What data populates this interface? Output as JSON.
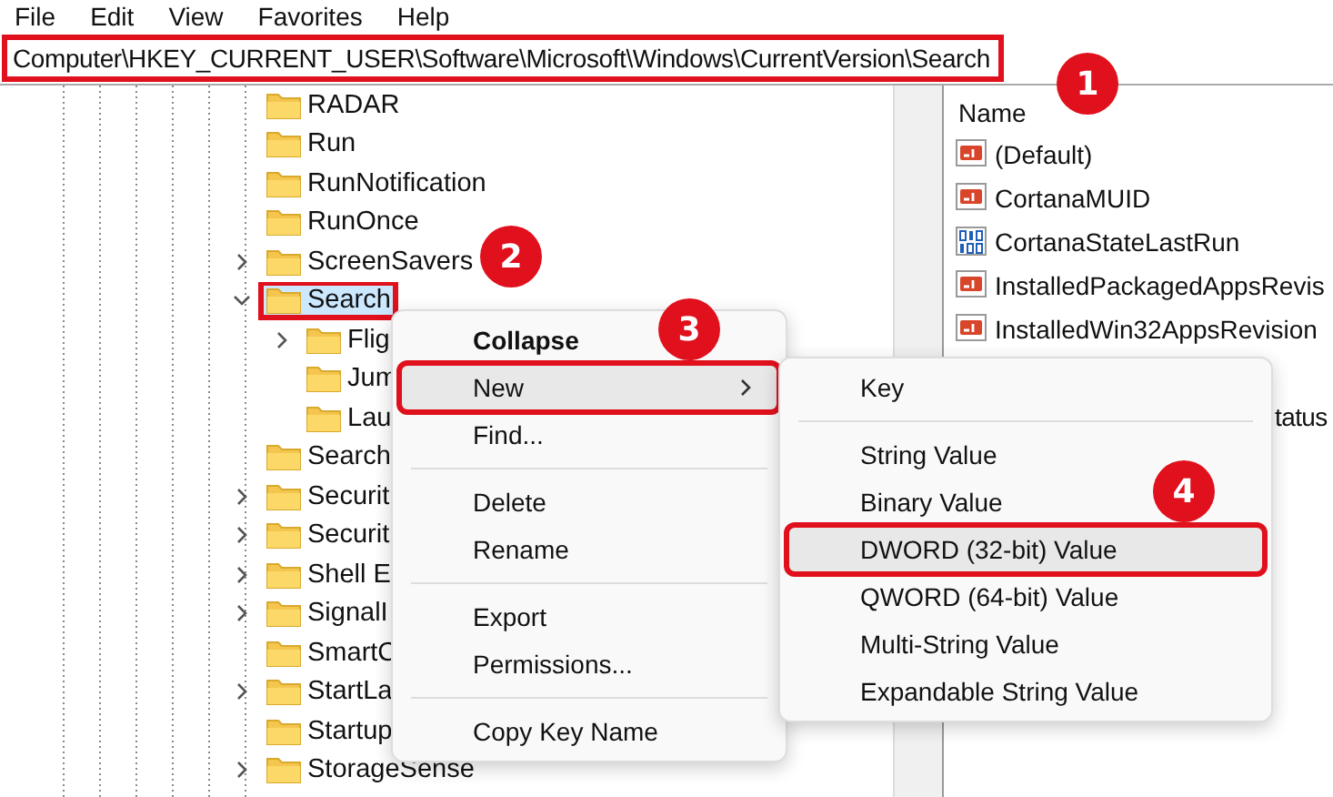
{
  "menubar": [
    "File",
    "Edit",
    "View",
    "Favorites",
    "Help"
  ],
  "address": {
    "value": "Computer\\HKEY_CURRENT_USER\\Software\\Microsoft\\Windows\\CurrentVersion\\Search",
    "annotated": true
  },
  "tree": [
    {
      "label": "RADAR",
      "expandable": false,
      "expanded": false,
      "selected": false,
      "annotated": false
    },
    {
      "label": "Run",
      "expandable": false,
      "expanded": false,
      "selected": false,
      "annotated": false
    },
    {
      "label": "RunNotification",
      "expandable": false,
      "expanded": false,
      "selected": false,
      "annotated": false
    },
    {
      "label": "RunOnce",
      "expandable": false,
      "expanded": false,
      "selected": false,
      "annotated": false
    },
    {
      "label": "ScreenSavers",
      "expandable": true,
      "expanded": false,
      "selected": false,
      "annotated": false
    },
    {
      "label": "Search",
      "expandable": true,
      "expanded": true,
      "selected": true,
      "annotated": true,
      "children": [
        {
          "label": "Flig",
          "expandable": true,
          "expanded": false,
          "selected": false,
          "annotated": false
        },
        {
          "label": "Jum",
          "expandable": false,
          "expanded": false,
          "selected": false,
          "annotated": false
        },
        {
          "label": "Lau",
          "expandable": false,
          "expanded": false,
          "selected": false,
          "annotated": false
        }
      ]
    },
    {
      "label": "Search",
      "expandable": false,
      "expanded": false,
      "selected": false,
      "annotated": false
    },
    {
      "label": "Securit",
      "expandable": true,
      "expanded": false,
      "selected": false,
      "annotated": false
    },
    {
      "label": "Securit",
      "expandable": true,
      "expanded": false,
      "selected": false,
      "annotated": false
    },
    {
      "label": "Shell E",
      "expandable": true,
      "expanded": false,
      "selected": false,
      "annotated": false
    },
    {
      "label": "SignalI",
      "expandable": true,
      "expanded": false,
      "selected": false,
      "annotated": false
    },
    {
      "label": "SmartC",
      "expandable": false,
      "expanded": false,
      "selected": false,
      "annotated": false
    },
    {
      "label": "StartLa",
      "expandable": true,
      "expanded": false,
      "selected": false,
      "annotated": false
    },
    {
      "label": "Startup",
      "expandable": false,
      "expanded": false,
      "selected": false,
      "annotated": false
    },
    {
      "label": "StorageSense",
      "expandable": true,
      "expanded": false,
      "selected": false,
      "annotated": false
    }
  ],
  "values": {
    "column": "Name",
    "rows": [
      {
        "kind": "string",
        "name": "(Default)"
      },
      {
        "kind": "string",
        "name": "CortanaMUID"
      },
      {
        "kind": "binary",
        "name": "CortanaStateLastRun"
      },
      {
        "kind": "string",
        "name": "InstalledPackagedAppsRevis"
      },
      {
        "kind": "string",
        "name": "InstalledWin32AppsRevision"
      },
      {
        "kind": "partial",
        "name": "tatus"
      }
    ]
  },
  "context_menu": [
    {
      "kind": "item",
      "label": "Collapse",
      "default": true,
      "submenu": false,
      "highlighted": false,
      "annotated": false
    },
    {
      "kind": "item",
      "label": "New",
      "default": false,
      "submenu": true,
      "highlighted": true,
      "annotated": true
    },
    {
      "kind": "item",
      "label": "Find...",
      "default": false,
      "submenu": false,
      "highlighted": false,
      "annotated": false
    },
    {
      "kind": "separator"
    },
    {
      "kind": "item",
      "label": "Delete",
      "default": false,
      "submenu": false,
      "highlighted": false,
      "annotated": false
    },
    {
      "kind": "item",
      "label": "Rename",
      "default": false,
      "submenu": false,
      "highlighted": false,
      "annotated": false
    },
    {
      "kind": "separator"
    },
    {
      "kind": "item",
      "label": "Export",
      "default": false,
      "submenu": false,
      "highlighted": false,
      "annotated": false
    },
    {
      "kind": "item",
      "label": "Permissions...",
      "default": false,
      "submenu": false,
      "highlighted": false,
      "annotated": false
    },
    {
      "kind": "separator"
    },
    {
      "kind": "item",
      "label": "Copy Key Name",
      "default": false,
      "submenu": false,
      "highlighted": false,
      "annotated": false
    }
  ],
  "submenu": [
    {
      "kind": "item",
      "label": "Key",
      "highlighted": false,
      "annotated": false
    },
    {
      "kind": "separator"
    },
    {
      "kind": "item",
      "label": "String Value",
      "highlighted": false,
      "annotated": false
    },
    {
      "kind": "item",
      "label": "Binary Value",
      "highlighted": false,
      "annotated": false
    },
    {
      "kind": "item",
      "label": "DWORD (32-bit) Value",
      "highlighted": true,
      "annotated": true
    },
    {
      "kind": "item",
      "label": "QWORD (64-bit) Value",
      "highlighted": false,
      "annotated": false
    },
    {
      "kind": "item",
      "label": "Multi-String Value",
      "highlighted": false,
      "annotated": false
    },
    {
      "kind": "item",
      "label": "Expandable String Value",
      "highlighted": false,
      "annotated": false
    }
  ],
  "badges": [
    "1",
    "2",
    "3",
    "4"
  ]
}
